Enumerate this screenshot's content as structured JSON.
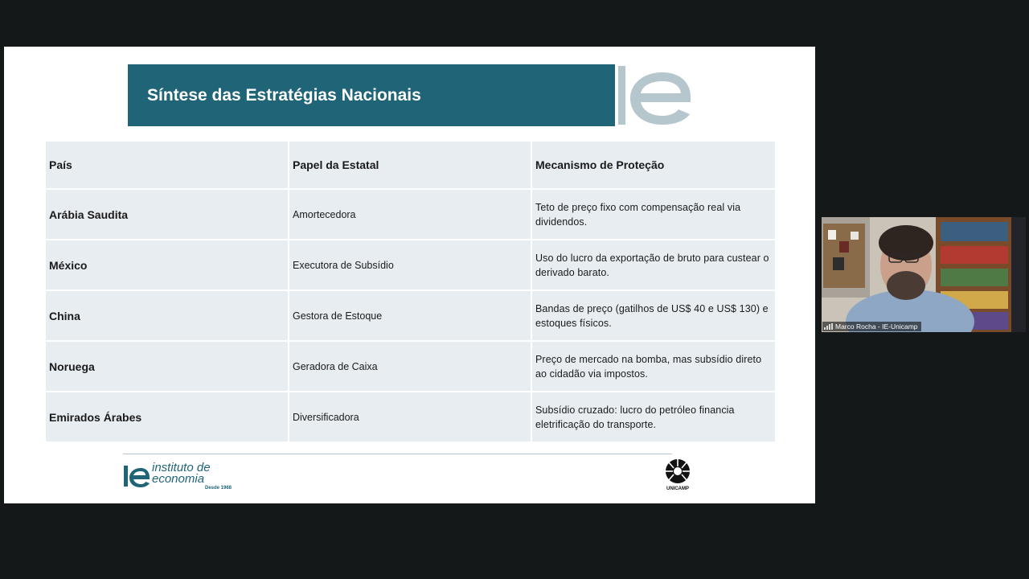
{
  "slide": {
    "title": "Síntese das Estratégias Nacionais",
    "headers": {
      "country": "País",
      "role": "Papel da Estatal",
      "mechanism": "Mecanismo de Proteção"
    },
    "rows": [
      {
        "country": "Arábia Saudita",
        "role": "Amortecedora",
        "mechanism": "Teto de preço fixo com compensação real via dividendos."
      },
      {
        "country": "México",
        "role": "Executora de Subsídio",
        "mechanism": "Uso do lucro da exportação de bruto para custear o derivado barato."
      },
      {
        "country": "China",
        "role": "Gestora de Estoque",
        "mechanism": "Bandas de preço (gatilhos de US$ 40 e US$ 130) e estoques físicos."
      },
      {
        "country": "Noruega",
        "role": "Geradora de Caixa",
        "mechanism": "Preço de mercado na bomba, mas subsídio direto ao cidadão via impostos."
      },
      {
        "country": "Emirados Árabes",
        "role": "Diversificadora",
        "mechanism": "Subsídio cruzado: lucro do petróleo financia eletrificação do transporte."
      }
    ],
    "footer": {
      "ie_logo_line1": "instituto de",
      "ie_logo_line2": "economia",
      "ie_logo_since": "Desde 1968",
      "unicamp_label": "UNICAMP"
    }
  },
  "participant": {
    "name": "Marco Rocha - IE-Unicamp"
  },
  "colors": {
    "title_bar": "#1f6477",
    "table_cell": "#e8edf2",
    "background": "#141818"
  }
}
